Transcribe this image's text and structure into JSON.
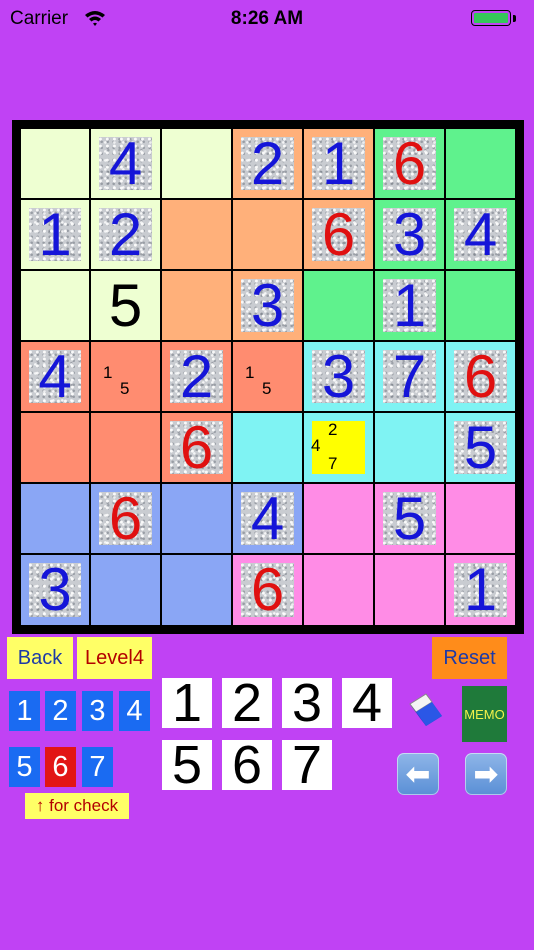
{
  "status_bar": {
    "carrier": "Carrier",
    "time": "8:26 AM"
  },
  "colors": {
    "background": "#c042f4",
    "red_digit": "#e01010",
    "blue_digit": "#1515d8",
    "check_blue": "#1a6bf2",
    "check_red": "#e21515"
  },
  "grid": {
    "rows": [
      [
        {
          "bg": "#eeffd2",
          "digit": "",
          "tile": false,
          "color": ""
        },
        {
          "bg": "#eeffd2",
          "digit": "4",
          "tile": true,
          "color": "blue"
        },
        {
          "bg": "#eeffd2",
          "digit": "",
          "tile": false,
          "color": ""
        },
        {
          "bg": "#ffb07a",
          "digit": "2",
          "tile": true,
          "color": "blue"
        },
        {
          "bg": "#ffb07a",
          "digit": "1",
          "tile": true,
          "color": "blue"
        },
        {
          "bg": "#5ff28d",
          "digit": "6",
          "tile": true,
          "color": "red"
        },
        {
          "bg": "#5ff28d",
          "digit": "",
          "tile": false,
          "color": ""
        }
      ],
      [
        {
          "bg": "#eeffd2",
          "digit": "1",
          "tile": true,
          "color": "blue"
        },
        {
          "bg": "#eeffd2",
          "digit": "2",
          "tile": true,
          "color": "blue"
        },
        {
          "bg": "#ffb07a",
          "digit": "",
          "tile": false,
          "color": ""
        },
        {
          "bg": "#ffb07a",
          "digit": "",
          "tile": false,
          "color": ""
        },
        {
          "bg": "#ffb07a",
          "digit": "6",
          "tile": true,
          "color": "red"
        },
        {
          "bg": "#5ff28d",
          "digit": "3",
          "tile": true,
          "color": "blue"
        },
        {
          "bg": "#5ff28d",
          "digit": "4",
          "tile": true,
          "color": "blue"
        }
      ],
      [
        {
          "bg": "#eeffd2",
          "digit": "",
          "tile": false,
          "color": ""
        },
        {
          "bg": "#eeffd2",
          "digit": "5",
          "tile": false,
          "color": "black"
        },
        {
          "bg": "#ffb07a",
          "digit": "",
          "tile": false,
          "color": ""
        },
        {
          "bg": "#ffb07a",
          "digit": "3",
          "tile": true,
          "color": "blue"
        },
        {
          "bg": "#5ff28d",
          "digit": "",
          "tile": false,
          "color": ""
        },
        {
          "bg": "#5ff28d",
          "digit": "1",
          "tile": true,
          "color": "blue"
        },
        {
          "bg": "#5ff28d",
          "digit": "",
          "tile": false,
          "color": ""
        }
      ],
      [
        {
          "bg": "#ff8c70",
          "digit": "4",
          "tile": true,
          "color": "blue"
        },
        {
          "bg": "#ff8c70",
          "digit": "",
          "tile": false,
          "color": "",
          "memo": [
            "1",
            "5"
          ]
        },
        {
          "bg": "#ff8c70",
          "digit": "2",
          "tile": true,
          "color": "blue"
        },
        {
          "bg": "#ff8c70",
          "digit": "",
          "tile": false,
          "color": "",
          "memo": [
            "1",
            "5"
          ]
        },
        {
          "bg": "#7ff3f3",
          "digit": "3",
          "tile": true,
          "color": "blue"
        },
        {
          "bg": "#7ff3f3",
          "digit": "7",
          "tile": true,
          "color": "blue"
        },
        {
          "bg": "#7ff3f3",
          "digit": "6",
          "tile": true,
          "color": "red"
        }
      ],
      [
        {
          "bg": "#ff8c70",
          "digit": "",
          "tile": false,
          "color": ""
        },
        {
          "bg": "#ff8c70",
          "digit": "",
          "tile": false,
          "color": ""
        },
        {
          "bg": "#ff8c70",
          "digit": "6",
          "tile": true,
          "color": "red"
        },
        {
          "bg": "#7ff3f3",
          "digit": "",
          "tile": false,
          "color": ""
        },
        {
          "bg": "#7ff3f3",
          "digit": "",
          "tile": false,
          "color": "",
          "selected": true,
          "memo": [
            "2",
            "4",
            "7"
          ]
        },
        {
          "bg": "#7ff3f3",
          "digit": "",
          "tile": false,
          "color": ""
        },
        {
          "bg": "#7ff3f3",
          "digit": "5",
          "tile": true,
          "color": "blue"
        }
      ],
      [
        {
          "bg": "#8aa6f5",
          "digit": "",
          "tile": false,
          "color": ""
        },
        {
          "bg": "#8aa6f5",
          "digit": "6",
          "tile": true,
          "color": "red"
        },
        {
          "bg": "#8aa6f5",
          "digit": "",
          "tile": false,
          "color": ""
        },
        {
          "bg": "#8aa6f5",
          "digit": "4",
          "tile": true,
          "color": "blue"
        },
        {
          "bg": "#ff8ce6",
          "digit": "",
          "tile": false,
          "color": ""
        },
        {
          "bg": "#ff8ce6",
          "digit": "5",
          "tile": true,
          "color": "blue"
        },
        {
          "bg": "#ff8ce6",
          "digit": "",
          "tile": false,
          "color": ""
        }
      ],
      [
        {
          "bg": "#8aa6f5",
          "digit": "3",
          "tile": true,
          "color": "blue"
        },
        {
          "bg": "#8aa6f5",
          "digit": "",
          "tile": false,
          "color": ""
        },
        {
          "bg": "#8aa6f5",
          "digit": "",
          "tile": false,
          "color": ""
        },
        {
          "bg": "#ff8ce6",
          "digit": "6",
          "tile": true,
          "color": "red"
        },
        {
          "bg": "#ff8ce6",
          "digit": "",
          "tile": false,
          "color": ""
        },
        {
          "bg": "#ff8ce6",
          "digit": "",
          "tile": false,
          "color": ""
        },
        {
          "bg": "#ff8ce6",
          "digit": "1",
          "tile": true,
          "color": "blue"
        }
      ]
    ]
  },
  "controls": {
    "back_label": "Back",
    "level_label": "Level4",
    "reset_label": "Reset",
    "check_numbers": [
      {
        "label": "1",
        "state": "blue"
      },
      {
        "label": "2",
        "state": "blue"
      },
      {
        "label": "3",
        "state": "blue"
      },
      {
        "label": "4",
        "state": "blue"
      },
      {
        "label": "5",
        "state": "blue"
      },
      {
        "label": "6",
        "state": "red"
      },
      {
        "label": "7",
        "state": "blue"
      }
    ],
    "check_caption": "↑ for check",
    "number_keys": [
      "1",
      "2",
      "3",
      "4",
      "5",
      "6",
      "7"
    ],
    "eraser_icon": "eraser-icon",
    "memo_label": "MEMO",
    "left_arrow": "⬅",
    "right_arrow": "➡"
  }
}
